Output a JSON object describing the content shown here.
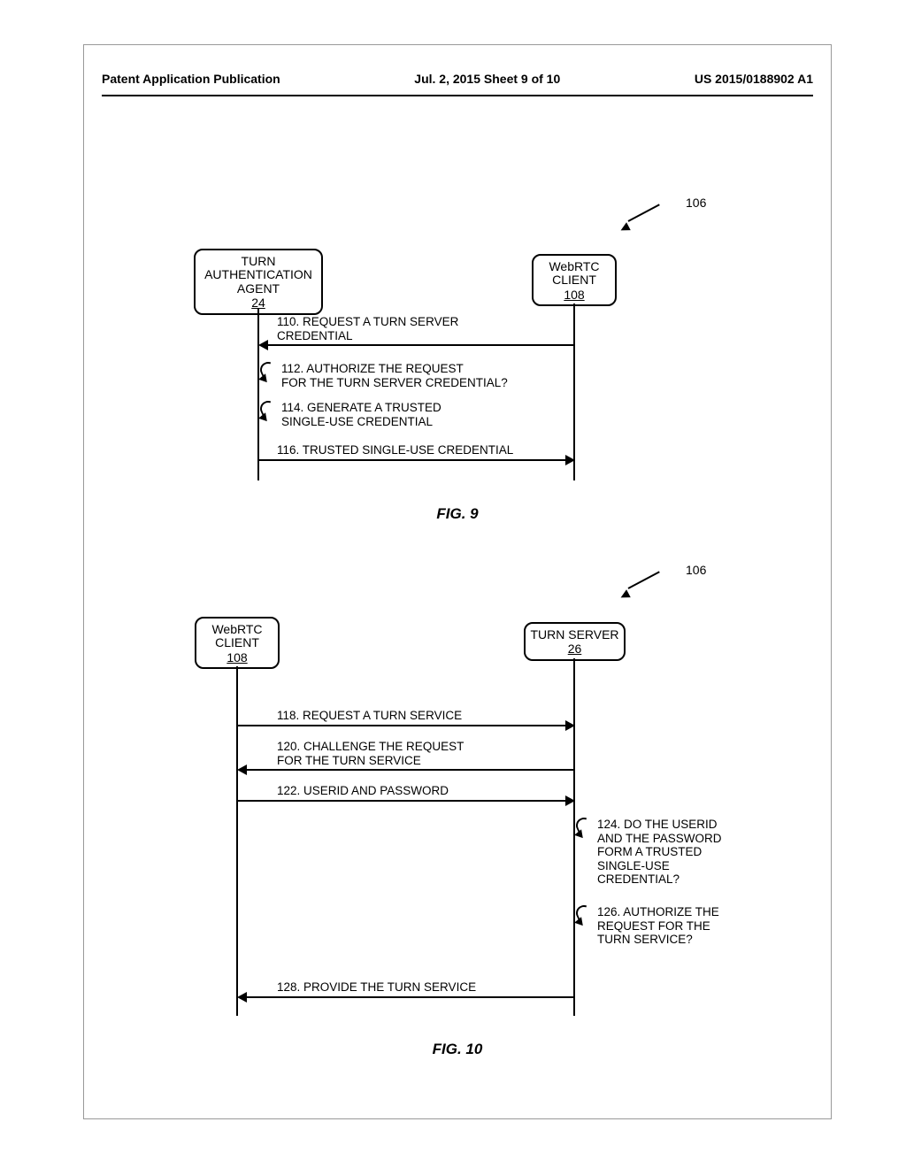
{
  "header": {
    "left": "Patent Application Publication",
    "center": "Jul. 2, 2015   Sheet 9 of 10",
    "right": "US 2015/0188902 A1"
  },
  "figure9": {
    "callout": "106",
    "actor_left": {
      "title": "TURN\nAUTHENTICATION\nAGENT",
      "ref": "24"
    },
    "actor_right": {
      "title": "WebRTC\nCLIENT",
      "ref": "108"
    },
    "msg110": "110. REQUEST A TURN SERVER\nCREDENTIAL",
    "msg112": "112. AUTHORIZE THE REQUEST\nFOR THE TURN SERVER CREDENTIAL?",
    "msg114": "114. GENERATE A TRUSTED\nSINGLE-USE CREDENTIAL",
    "msg116": "116. TRUSTED SINGLE-USE CREDENTIAL",
    "label": "FIG. 9"
  },
  "figure10": {
    "callout": "106",
    "actor_left": {
      "title": "WebRTC\nCLIENT",
      "ref": "108"
    },
    "actor_right": {
      "title": "TURN SERVER",
      "ref": "26"
    },
    "msg118": "118. REQUEST A TURN SERVICE",
    "msg120": "120. CHALLENGE THE REQUEST\nFOR THE TURN SERVICE",
    "msg122": "122. USERID AND PASSWORD",
    "msg124": "124. DO THE USERID\nAND THE PASSWORD\nFORM A TRUSTED\nSINGLE-USE\nCREDENTIAL?",
    "msg126": "126. AUTHORIZE THE\nREQUEST FOR THE\nTURN SERVICE?",
    "msg128": "128. PROVIDE THE TURN SERVICE",
    "label": "FIG. 10"
  }
}
